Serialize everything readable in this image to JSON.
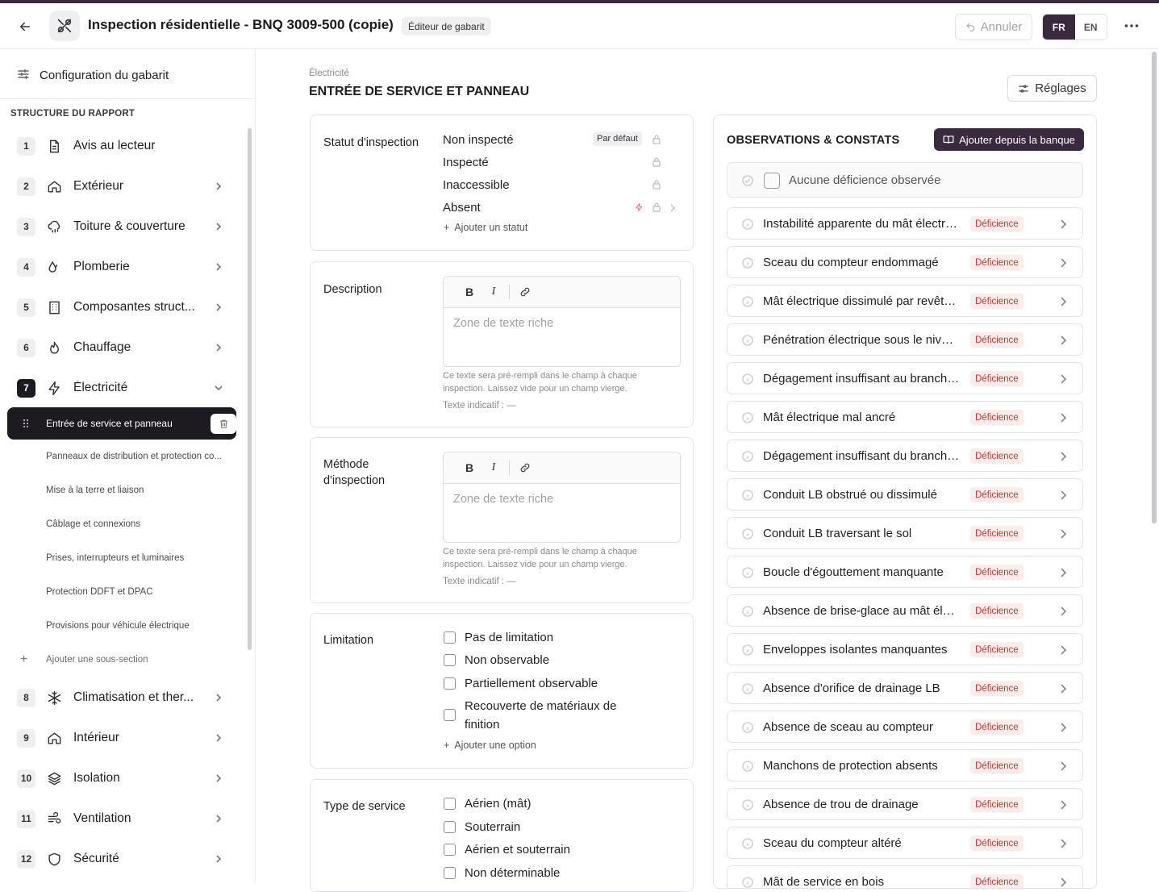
{
  "header": {
    "title": "Inspection résidentielle - BNQ 3009-500 (copie)",
    "badge": "Éditeur de gabarit",
    "undo_label": "Annuler",
    "lang_fr": "FR",
    "lang_en": "EN",
    "active_lang": "FR",
    "icons": [
      "arrow-left-icon",
      "tools-icon",
      "undo-icon",
      "more-horizontal-icon"
    ]
  },
  "sidebar": {
    "config_label": "Configuration du gabarit",
    "structure_label": "STRUCTURE DU RAPPORT",
    "sections": [
      {
        "num": "1",
        "label": "Avis au lecteur",
        "icon": "document-icon"
      },
      {
        "num": "2",
        "label": "Extérieur",
        "icon": "home-icon"
      },
      {
        "num": "3",
        "label": "Toiture & couverture",
        "icon": "cloud-rain-icon"
      },
      {
        "num": "4",
        "label": "Plomberie",
        "icon": "droplets-icon"
      },
      {
        "num": "5",
        "label": "Composantes struct...",
        "icon": "building-icon"
      },
      {
        "num": "6",
        "label": "Chauffage",
        "icon": "flame-icon"
      },
      {
        "num": "7",
        "label": "Électricité",
        "icon": "zap-icon",
        "expanded": true
      },
      {
        "num": "8",
        "label": "Climatisation et ther...",
        "icon": "snowflake-icon"
      },
      {
        "num": "9",
        "label": "Intérieur",
        "icon": "home-icon"
      },
      {
        "num": "10",
        "label": "Isolation",
        "icon": "layers-icon"
      },
      {
        "num": "11",
        "label": "Ventilation",
        "icon": "wind-icon"
      },
      {
        "num": "12",
        "label": "Sécurité",
        "icon": "shield-icon"
      }
    ],
    "subsections": [
      "Entrée de service et panneau",
      "Panneaux de distribution et protection co...",
      "Mise à la terre et liaison",
      "Câblage et connexions",
      "Prises, interrupteurs et luminaires",
      "Protection DDFT et DPAC",
      "Provisions pour véhicule électrique"
    ],
    "active_subsection": "Entrée de service et panneau",
    "add_subsection": "Ajouter une sous-section"
  },
  "main": {
    "breadcrumb": "Électricité",
    "title": "ENTRÉE DE SERVICE ET PANNEAU",
    "settings_label": "Réglages",
    "status": {
      "label": "Statut d'inspection",
      "options": [
        "Non inspecté",
        "Inspecté",
        "Inaccessible",
        "Absent"
      ],
      "default_badge": "Par défaut",
      "add_label": "Ajouter un statut"
    },
    "description": {
      "label": "Description",
      "placeholder": "Zone de texte riche",
      "hint": "Ce texte sera pré-rempli dans le champ à chaque inspection. Laissez vide pour un champ vierge.",
      "indicative": "Texte indicatif :  —"
    },
    "method": {
      "label": "Méthode d'inspection",
      "placeholder": "Zone de texte riche",
      "hint": "Ce texte sera pré-rempli dans le champ à chaque inspection. Laissez vide pour un champ vierge.",
      "indicative": "Texte indicatif :  —"
    },
    "limitation": {
      "label": "Limitation",
      "options": [
        "Pas de limitation",
        "Non observable",
        "Partiellement observable",
        "Recouverte de matériaux de finition"
      ],
      "add_label": "Ajouter une option"
    },
    "service_type": {
      "label": "Type de service",
      "options": [
        "Aérien (mât)",
        "Souterrain",
        "Aérien et souterrain",
        "Non déterminable"
      ]
    }
  },
  "observations": {
    "title": "OBSERVATIONS & CONSTATS",
    "bank_button": "Ajouter depuis la banque",
    "none_label": "Aucune déficience observée",
    "badge": "Déficience",
    "items": [
      "Instabilité apparente du mât électrique",
      "Sceau du compteur endommagé",
      "Mât électrique dissimulé par revêtement",
      "Pénétration électrique sous le niveau",
      "Dégagement insuffisant au branchement",
      "Mât électrique mal ancré",
      "Dégagement insuffisant du branchement",
      "Conduit LB obstrué ou dissimulé",
      "Conduit LB traversant le sol",
      "Boucle d'égouttement manquante",
      "Absence de brise-glace au mât électrique",
      "Enveloppes isolantes manquantes",
      "Absence d'orifice de drainage LB",
      "Absence de sceau au compteur",
      "Manchons de protection absents",
      "Absence de trou de drainage",
      "Sceau du compteur altéré",
      "Mât de service en bois"
    ]
  }
}
